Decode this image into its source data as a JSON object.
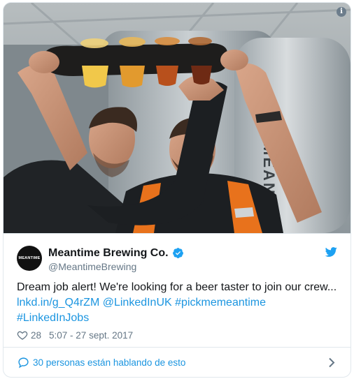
{
  "account": {
    "name": "Meantime Brewing Co.",
    "handle": "@MeantimeBrewing",
    "avatar_text": "MEANTIME"
  },
  "tweet": {
    "text": "Dream job alert! We're looking for a beer taster to join our crew...",
    "link": "lnkd.in/g_Q4rZM",
    "mention": "@LinkedInUK",
    "hashtag_1": "#pickmemeantime",
    "hashtag_2": "#LinkedInJobs"
  },
  "stats": {
    "likes": "28",
    "timestamp": "5:07 - 27 sept. 2017"
  },
  "footer": {
    "conversation_label": "30 personas están hablando de esto"
  },
  "media": {
    "info_label": "i",
    "tank_text": "MEANTIME"
  },
  "colors": {
    "link": "#1b95e0",
    "text": "#14171a",
    "muted": "#657786",
    "border": "#e1e8ed",
    "twitter_blue": "#1da1f2"
  },
  "icons": [
    "info-icon",
    "verified-badge-icon",
    "twitter-bird-icon",
    "heart-icon",
    "speech-bubble-icon",
    "chevron-right-icon"
  ]
}
